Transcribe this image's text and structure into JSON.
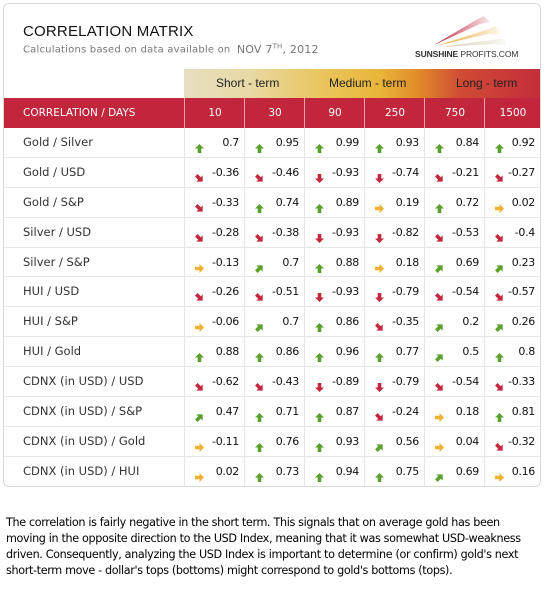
{
  "header": {
    "title": "CORRELATION MATRIX",
    "subtitle": "Calculations based on data available on",
    "date_main": "NOV 7",
    "date_sup": "TH",
    "date_year": ", 2012",
    "logo_bold": "SUNSHINE",
    "logo_rest": " PROFITS.COM"
  },
  "terms": [
    "Short - term",
    "Medium - term",
    "Long - term"
  ],
  "colors": {
    "header_red": "#c2263c",
    "up_green": "#5aa02c",
    "down_red": "#c4283e",
    "flat_orange": "#f0b030"
  },
  "table": {
    "corner_label": "CORRELATION / DAYS",
    "columns": [
      "10",
      "30",
      "90",
      "250",
      "750",
      "1500"
    ],
    "rows": [
      {
        "label": "Gold / Silver",
        "cells": [
          {
            "v": "0.7",
            "icon": "arrow-up-icon"
          },
          {
            "v": "0.95",
            "icon": "arrow-up-icon"
          },
          {
            "v": "0.99",
            "icon": "arrow-up-icon"
          },
          {
            "v": "0.93",
            "icon": "arrow-up-icon"
          },
          {
            "v": "0.84",
            "icon": "arrow-up-icon"
          },
          {
            "v": "0.92",
            "icon": "arrow-up-icon"
          }
        ]
      },
      {
        "label": "Gold / USD",
        "cells": [
          {
            "v": "-0.36",
            "icon": "arrow-down-right-icon"
          },
          {
            "v": "-0.46",
            "icon": "arrow-down-right-icon"
          },
          {
            "v": "-0.93",
            "icon": "arrow-down-icon"
          },
          {
            "v": "-0.74",
            "icon": "arrow-down-icon"
          },
          {
            "v": "-0.21",
            "icon": "arrow-down-right-icon"
          },
          {
            "v": "-0.27",
            "icon": "arrow-down-right-icon"
          }
        ]
      },
      {
        "label": "Gold / S&P",
        "cells": [
          {
            "v": "-0.33",
            "icon": "arrow-down-right-icon"
          },
          {
            "v": "0.74",
            "icon": "arrow-up-icon"
          },
          {
            "v": "0.89",
            "icon": "arrow-up-icon"
          },
          {
            "v": "0.19",
            "icon": "arrow-right-icon"
          },
          {
            "v": "0.72",
            "icon": "arrow-up-icon"
          },
          {
            "v": "0.02",
            "icon": "arrow-right-icon"
          }
        ]
      },
      {
        "label": "Silver / USD",
        "cells": [
          {
            "v": "-0.28",
            "icon": "arrow-down-right-icon"
          },
          {
            "v": "-0.38",
            "icon": "arrow-down-right-icon"
          },
          {
            "v": "-0.93",
            "icon": "arrow-down-icon"
          },
          {
            "v": "-0.82",
            "icon": "arrow-down-icon"
          },
          {
            "v": "-0.53",
            "icon": "arrow-down-right-icon"
          },
          {
            "v": "-0.4",
            "icon": "arrow-down-right-icon"
          }
        ]
      },
      {
        "label": "Silver / S&P",
        "cells": [
          {
            "v": "-0.13",
            "icon": "arrow-right-icon"
          },
          {
            "v": "0.7",
            "icon": "arrow-up-right-icon"
          },
          {
            "v": "0.88",
            "icon": "arrow-up-icon"
          },
          {
            "v": "0.18",
            "icon": "arrow-right-icon"
          },
          {
            "v": "0.69",
            "icon": "arrow-up-right-icon"
          },
          {
            "v": "0.23",
            "icon": "arrow-up-right-icon"
          }
        ]
      },
      {
        "label": "HUI / USD",
        "cells": [
          {
            "v": "-0.26",
            "icon": "arrow-down-right-icon"
          },
          {
            "v": "-0.51",
            "icon": "arrow-down-right-icon"
          },
          {
            "v": "-0.93",
            "icon": "arrow-down-icon"
          },
          {
            "v": "-0.79",
            "icon": "arrow-down-icon"
          },
          {
            "v": "-0.54",
            "icon": "arrow-down-right-icon"
          },
          {
            "v": "-0.57",
            "icon": "arrow-down-right-icon"
          }
        ]
      },
      {
        "label": "HUI / S&P",
        "cells": [
          {
            "v": "-0.06",
            "icon": "arrow-right-icon"
          },
          {
            "v": "0.7",
            "icon": "arrow-up-right-icon"
          },
          {
            "v": "0.86",
            "icon": "arrow-up-icon"
          },
          {
            "v": "-0.35",
            "icon": "arrow-down-right-icon"
          },
          {
            "v": "0.2",
            "icon": "arrow-up-right-icon"
          },
          {
            "v": "0.26",
            "icon": "arrow-up-right-icon"
          }
        ]
      },
      {
        "label": "HUI / Gold",
        "cells": [
          {
            "v": "0.88",
            "icon": "arrow-up-icon"
          },
          {
            "v": "0.86",
            "icon": "arrow-up-icon"
          },
          {
            "v": "0.96",
            "icon": "arrow-up-icon"
          },
          {
            "v": "0.77",
            "icon": "arrow-up-icon"
          },
          {
            "v": "0.5",
            "icon": "arrow-up-right-icon"
          },
          {
            "v": "0.8",
            "icon": "arrow-up-icon"
          }
        ]
      },
      {
        "label": "CDNX (in USD) / USD",
        "cells": [
          {
            "v": "-0.62",
            "icon": "arrow-down-right-icon"
          },
          {
            "v": "-0.43",
            "icon": "arrow-down-right-icon"
          },
          {
            "v": "-0.89",
            "icon": "arrow-down-icon"
          },
          {
            "v": "-0.79",
            "icon": "arrow-down-icon"
          },
          {
            "v": "-0.54",
            "icon": "arrow-down-right-icon"
          },
          {
            "v": "-0.33",
            "icon": "arrow-down-right-icon"
          }
        ]
      },
      {
        "label": "CDNX (in USD) / S&P",
        "cells": [
          {
            "v": "0.47",
            "icon": "arrow-up-right-icon"
          },
          {
            "v": "0.71",
            "icon": "arrow-up-icon"
          },
          {
            "v": "0.87",
            "icon": "arrow-up-icon"
          },
          {
            "v": "-0.24",
            "icon": "arrow-down-right-icon"
          },
          {
            "v": "0.18",
            "icon": "arrow-right-icon"
          },
          {
            "v": "0.81",
            "icon": "arrow-up-icon"
          }
        ]
      },
      {
        "label": "CDNX (in USD) / Gold",
        "cells": [
          {
            "v": "-0.11",
            "icon": "arrow-right-icon"
          },
          {
            "v": "0.76",
            "icon": "arrow-up-icon"
          },
          {
            "v": "0.93",
            "icon": "arrow-up-icon"
          },
          {
            "v": "0.56",
            "icon": "arrow-up-right-icon"
          },
          {
            "v": "0.04",
            "icon": "arrow-right-icon"
          },
          {
            "v": "-0.32",
            "icon": "arrow-down-right-icon"
          }
        ]
      },
      {
        "label": "CDNX (in USD) / HUI",
        "cells": [
          {
            "v": "0.02",
            "icon": "arrow-right-icon"
          },
          {
            "v": "0.73",
            "icon": "arrow-up-icon"
          },
          {
            "v": "0.94",
            "icon": "arrow-up-icon"
          },
          {
            "v": "0.75",
            "icon": "arrow-up-icon"
          },
          {
            "v": "0.69",
            "icon": "arrow-up-right-icon"
          },
          {
            "v": "0.16",
            "icon": "arrow-right-icon"
          }
        ]
      }
    ]
  },
  "commentary": "The correlation is fairly negative in the short term. This signals that on average gold has been moving in the opposite direction to the USD Index, meaning that it was somewhat USD-weakness driven. Consequently, analyzing the USD Index is important to determine (or confirm) gold's next short-term move - dollar's tops (bottoms) might correspond to gold's bottoms (tops)."
}
